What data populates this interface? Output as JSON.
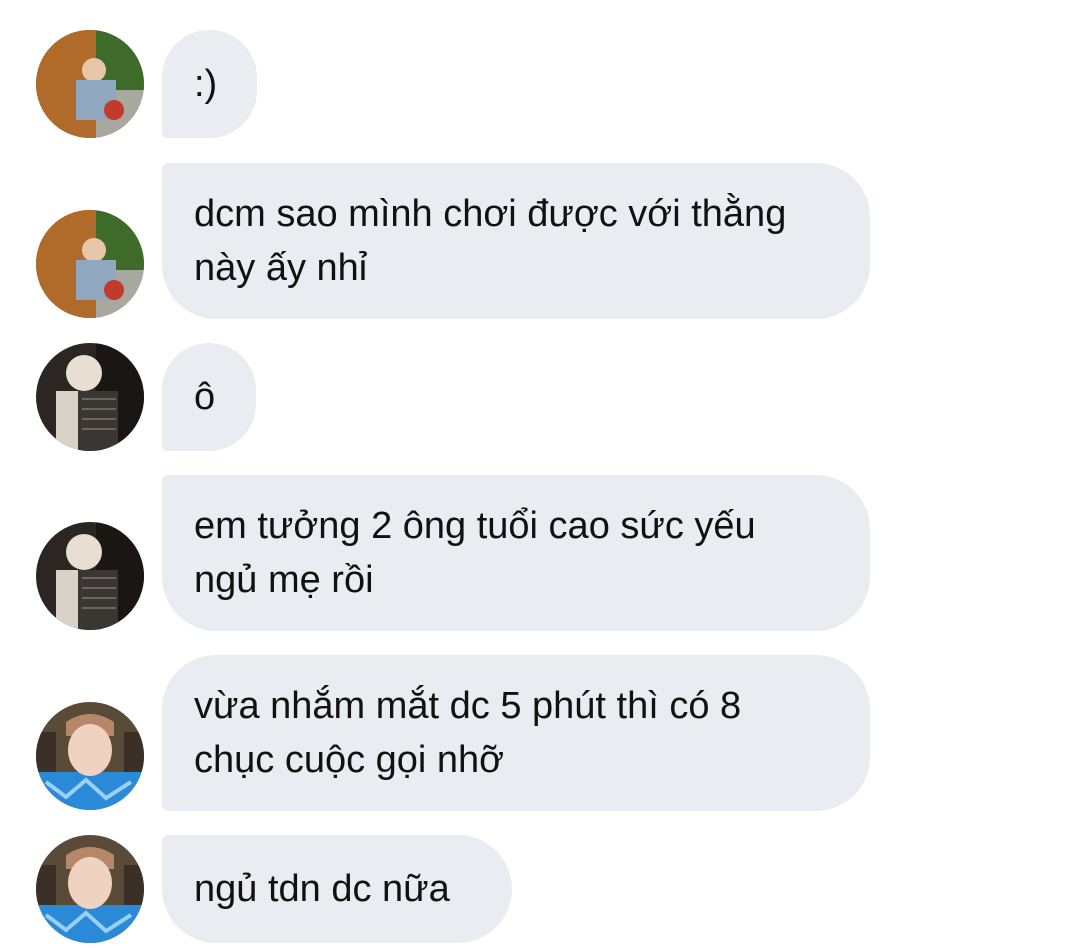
{
  "messages": [
    {
      "sender": "user-a",
      "text": ":)"
    },
    {
      "sender": "user-a",
      "text": "dcm sao mình chơi được với thằng\nnày ấy nhỉ"
    },
    {
      "sender": "user-b",
      "text": "ô"
    },
    {
      "sender": "user-b",
      "text": "em tưởng 2 ông tuổi cao sức yếu\nngủ mẹ rồi"
    },
    {
      "sender": "user-c",
      "text": "vừa nhắm mắt dc 5 phút thì có 8\nchục cuộc gọi nhỡ"
    },
    {
      "sender": "user-c",
      "text": "ngủ tdn dc nữa"
    }
  ],
  "colors": {
    "bubble_bg": "#e9ecf0",
    "text": "#111111",
    "background": "#ffffff"
  }
}
